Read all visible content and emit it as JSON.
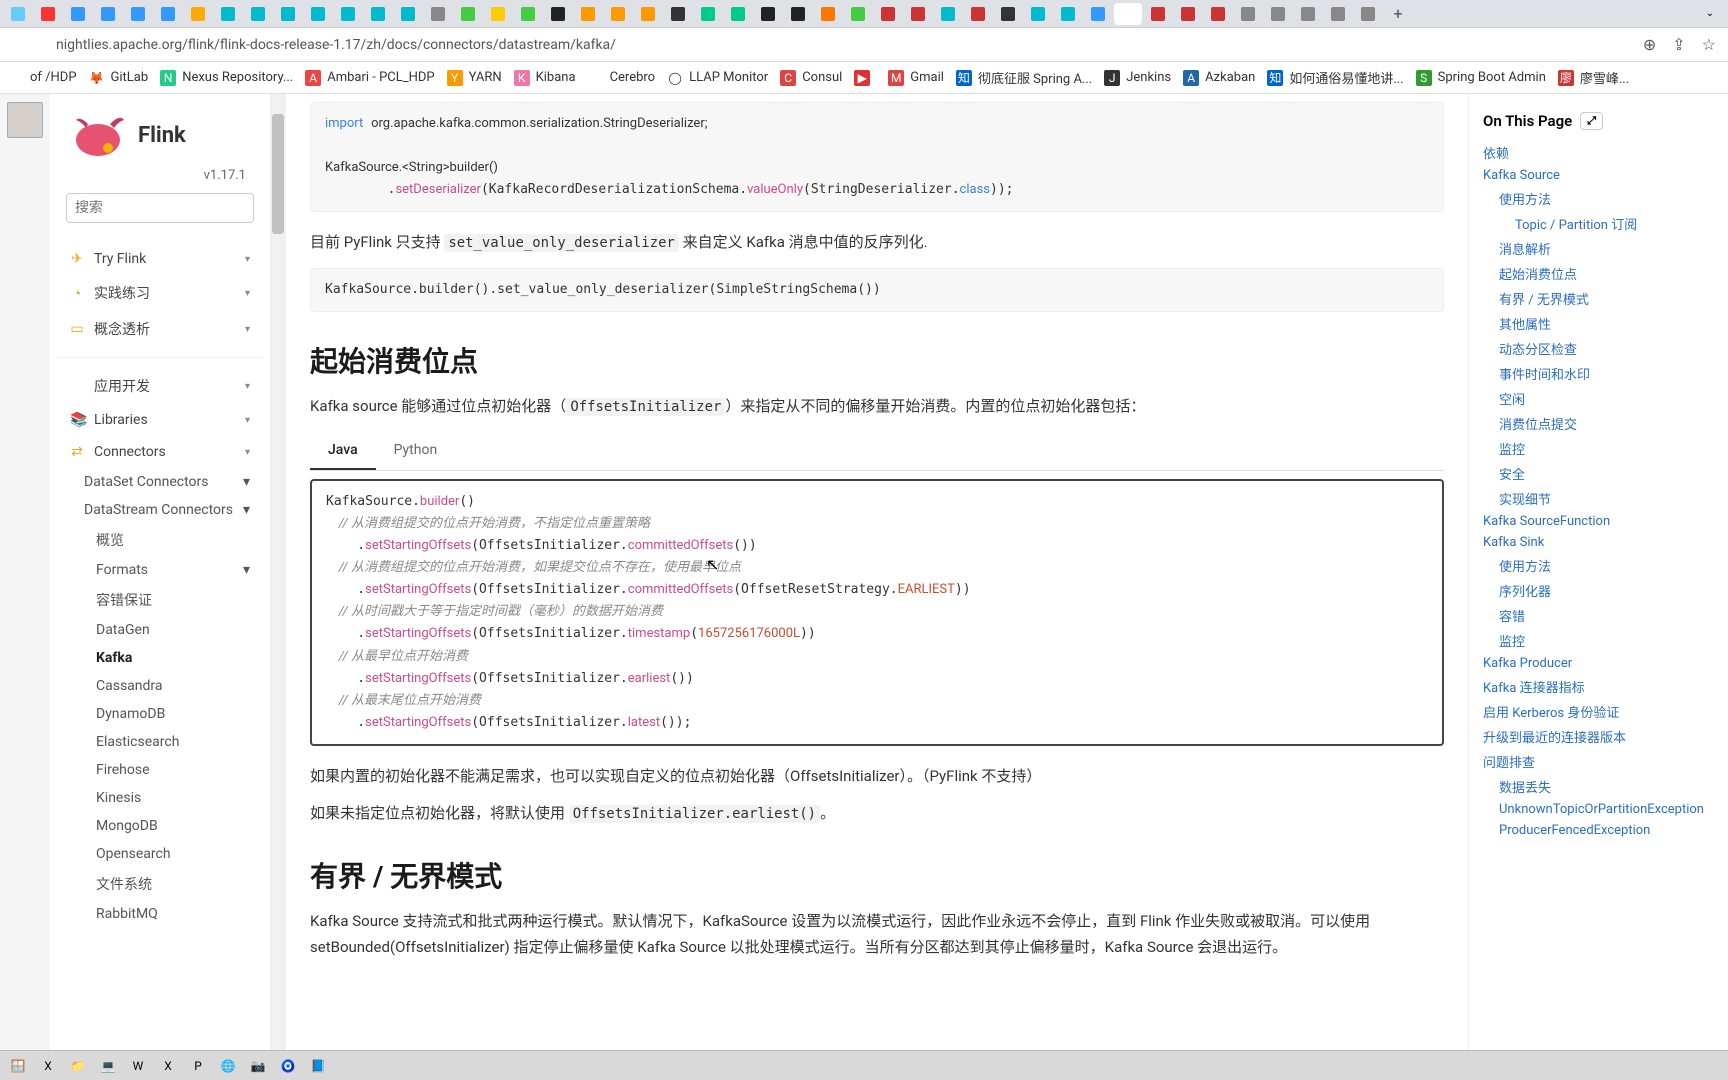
{
  "browser": {
    "url": "nightlies.apache.org/flink/flink-docs-release-1.17/zh/docs/connectors/datastream/kafka/",
    "new_tab_label": "+",
    "url_actions": {
      "zoom": "⊕",
      "share": "⇪",
      "star": "☆"
    }
  },
  "bookmarks": [
    {
      "icon": "",
      "bg": "",
      "label": "of /HDP"
    },
    {
      "icon": "🦊",
      "bg": "",
      "label": "GitLab"
    },
    {
      "icon": "N",
      "bg": "#2c8",
      "label": "Nexus Repository..."
    },
    {
      "icon": "A",
      "bg": "#e44",
      "label": "Ambari - PCL_HDP"
    },
    {
      "icon": "Y",
      "bg": "#f90",
      "label": "YARN"
    },
    {
      "icon": "K",
      "bg": "#e7a",
      "label": "Kibana"
    },
    {
      "icon": "",
      "bg": "",
      "label": "Cerebro"
    },
    {
      "icon": "◯",
      "bg": "",
      "label": "LLAP Monitor"
    },
    {
      "icon": "C",
      "bg": "#d44",
      "label": "Consul"
    },
    {
      "icon": "▶",
      "bg": "#d33",
      "label": ""
    },
    {
      "icon": "M",
      "bg": "#d44",
      "label": "Gmail"
    },
    {
      "icon": "知",
      "bg": "#06c",
      "label": "彻底征服 Spring A..."
    },
    {
      "icon": "J",
      "bg": "#333",
      "label": "Jenkins"
    },
    {
      "icon": "A",
      "bg": "#26a",
      "label": "Azkaban"
    },
    {
      "icon": "知",
      "bg": "#06c",
      "label": "如何通俗易懂地讲..."
    },
    {
      "icon": "S",
      "bg": "#393",
      "label": "Spring Boot Admin"
    },
    {
      "icon": "廖",
      "bg": "#c33",
      "label": "廖雪峰..."
    }
  ],
  "sidebar": {
    "product": "Flink",
    "version": "v1.17.1",
    "search_placeholder": "搜索",
    "top_nav": [
      {
        "icon": "✈",
        "col": "#f5a623",
        "label": "Try Flink"
      },
      {
        "icon": "◔",
        "col": "#f5a623",
        "label": "实践练习"
      },
      {
        "icon": "▭",
        "col": "#f5a623",
        "label": "概念透析"
      }
    ],
    "dev_nav": [
      {
        "icon": "</>",
        "label": "应用开发"
      },
      {
        "icon": "📚",
        "label": "Libraries"
      },
      {
        "icon": "⇄",
        "label": "Connectors"
      }
    ],
    "connectors": [
      {
        "label": "DataSet Connectors",
        "expandable": true
      },
      {
        "label": "DataStream Connectors",
        "expandable": true,
        "children": [
          {
            "label": "概览"
          },
          {
            "label": "Formats",
            "expandable": true
          },
          {
            "label": "容错保证"
          },
          {
            "label": "DataGen"
          },
          {
            "label": "Kafka",
            "active": true
          },
          {
            "label": "Cassandra"
          },
          {
            "label": "DynamoDB"
          },
          {
            "label": "Elasticsearch"
          },
          {
            "label": "Firehose"
          },
          {
            "label": "Kinesis"
          },
          {
            "label": "MongoDB"
          },
          {
            "label": "Opensearch"
          },
          {
            "label": "文件系统"
          },
          {
            "label": "RabbitMQ"
          }
        ]
      }
    ]
  },
  "content": {
    "code1_line1": "import org.apache.kafka.common.serialization.StringDeserializer;",
    "code1_line2": "KafkaSource.<String>builder()",
    "code1_line3": "        .setDeserializer(KafkaRecordDeserializationSchema.valueOnly(StringDeserializer.class));",
    "p1_pre": "目前 PyFlink 只支持 ",
    "p1_code": "set_value_only_deserializer",
    "p1_post": " 来自定义 Kafka 消息中值的反序列化.",
    "code2": "KafkaSource.builder().set_value_only_deserializer(SimpleStringSchema())",
    "h1": "起始消费位点",
    "p2_pre": "Kafka source 能够通过位点初始化器（",
    "p2_code": "OffsetsInitializer",
    "p2_post": "）来指定从不同的偏移量开始消费。内置的位点初始化器包括：",
    "tabs": {
      "java": "Java",
      "python": "Python"
    },
    "code3": {
      "l1": "KafkaSource.builder()",
      "c1": "    // 从消费组提交的位点开始消费，不指定位点重置策略",
      "l2": "    .setStartingOffsets(OffsetsInitializer.committedOffsets())",
      "c2": "    // 从消费组提交的位点开始消费，如果提交位点不存在，使用最早位点",
      "l3": "    .setStartingOffsets(OffsetsInitializer.committedOffsets(OffsetResetStrategy.EARLIEST))",
      "c3": "    // 从时间戳大于等于指定时间戳（毫秒）的数据开始消费",
      "l4_a": "    .setStartingOffsets(OffsetsInitializer.timestamp(",
      "l4_num": "1657256176000L",
      "l4_b": "))",
      "c4": "    // 从最早位点开始消费",
      "l5": "    .setStartingOffsets(OffsetsInitializer.earliest())",
      "c5": "    // 从最末尾位点开始消费",
      "l6": "    .setStartingOffsets(OffsetsInitializer.latest());"
    },
    "p3": "如果内置的初始化器不能满足需求，也可以实现自定义的位点初始化器（OffsetsInitializer）。（PyFlink 不支持）",
    "p4_pre": "如果未指定位点初始化器，将默认使用 ",
    "p4_code": "OffsetsInitializer.earliest()",
    "p4_post": "。",
    "h2": "有界 / 无界模式",
    "p5": "Kafka Source 支持流式和批式两种运行模式。默认情况下，KafkaSource 设置为以流模式运行，因此作业永远不会停止，直到 Flink 作业失败或被取消。可以使用 setBounded(OffsetsInitializer) 指定停止偏移量使 Kafka Source 以批处理模式运行。当所有分区都达到其停止偏移量时，Kafka Source 会退出运行。"
  },
  "toc": {
    "title": "On This Page",
    "items": [
      {
        "d": 1,
        "t": "依赖"
      },
      {
        "d": 1,
        "t": "Kafka Source"
      },
      {
        "d": 2,
        "t": "使用方法"
      },
      {
        "d": 3,
        "t": "Topic / Partition 订阅"
      },
      {
        "d": 2,
        "t": "消息解析"
      },
      {
        "d": 2,
        "t": "起始消费位点"
      },
      {
        "d": 2,
        "t": "有界 / 无界模式"
      },
      {
        "d": 2,
        "t": "其他属性"
      },
      {
        "d": 2,
        "t": "动态分区检查"
      },
      {
        "d": 2,
        "t": "事件时间和水印"
      },
      {
        "d": 2,
        "t": "空闲"
      },
      {
        "d": 2,
        "t": "消费位点提交"
      },
      {
        "d": 2,
        "t": "监控"
      },
      {
        "d": 2,
        "t": "安全"
      },
      {
        "d": 2,
        "t": "实现细节"
      },
      {
        "d": 1,
        "t": "Kafka SourceFunction"
      },
      {
        "d": 1,
        "t": "Kafka Sink"
      },
      {
        "d": 2,
        "t": "使用方法"
      },
      {
        "d": 2,
        "t": "序列化器"
      },
      {
        "d": 2,
        "t": "容错"
      },
      {
        "d": 2,
        "t": "监控"
      },
      {
        "d": 1,
        "t": "Kafka Producer"
      },
      {
        "d": 1,
        "t": "Kafka 连接器指标"
      },
      {
        "d": 1,
        "t": "启用 Kerberos 身份验证"
      },
      {
        "d": 1,
        "t": "升级到最近的连接器版本"
      },
      {
        "d": 1,
        "t": "问题排查"
      },
      {
        "d": 2,
        "t": "数据丢失"
      },
      {
        "d": 2,
        "t": "UnknownTopicOrPartitionException"
      },
      {
        "d": 2,
        "t": "ProducerFencedException"
      }
    ]
  },
  "taskbar_apps": [
    "🪟",
    "X",
    "📁",
    "💻",
    "W",
    "X",
    "P",
    "🌐",
    "📷",
    "🧿",
    "📘"
  ]
}
